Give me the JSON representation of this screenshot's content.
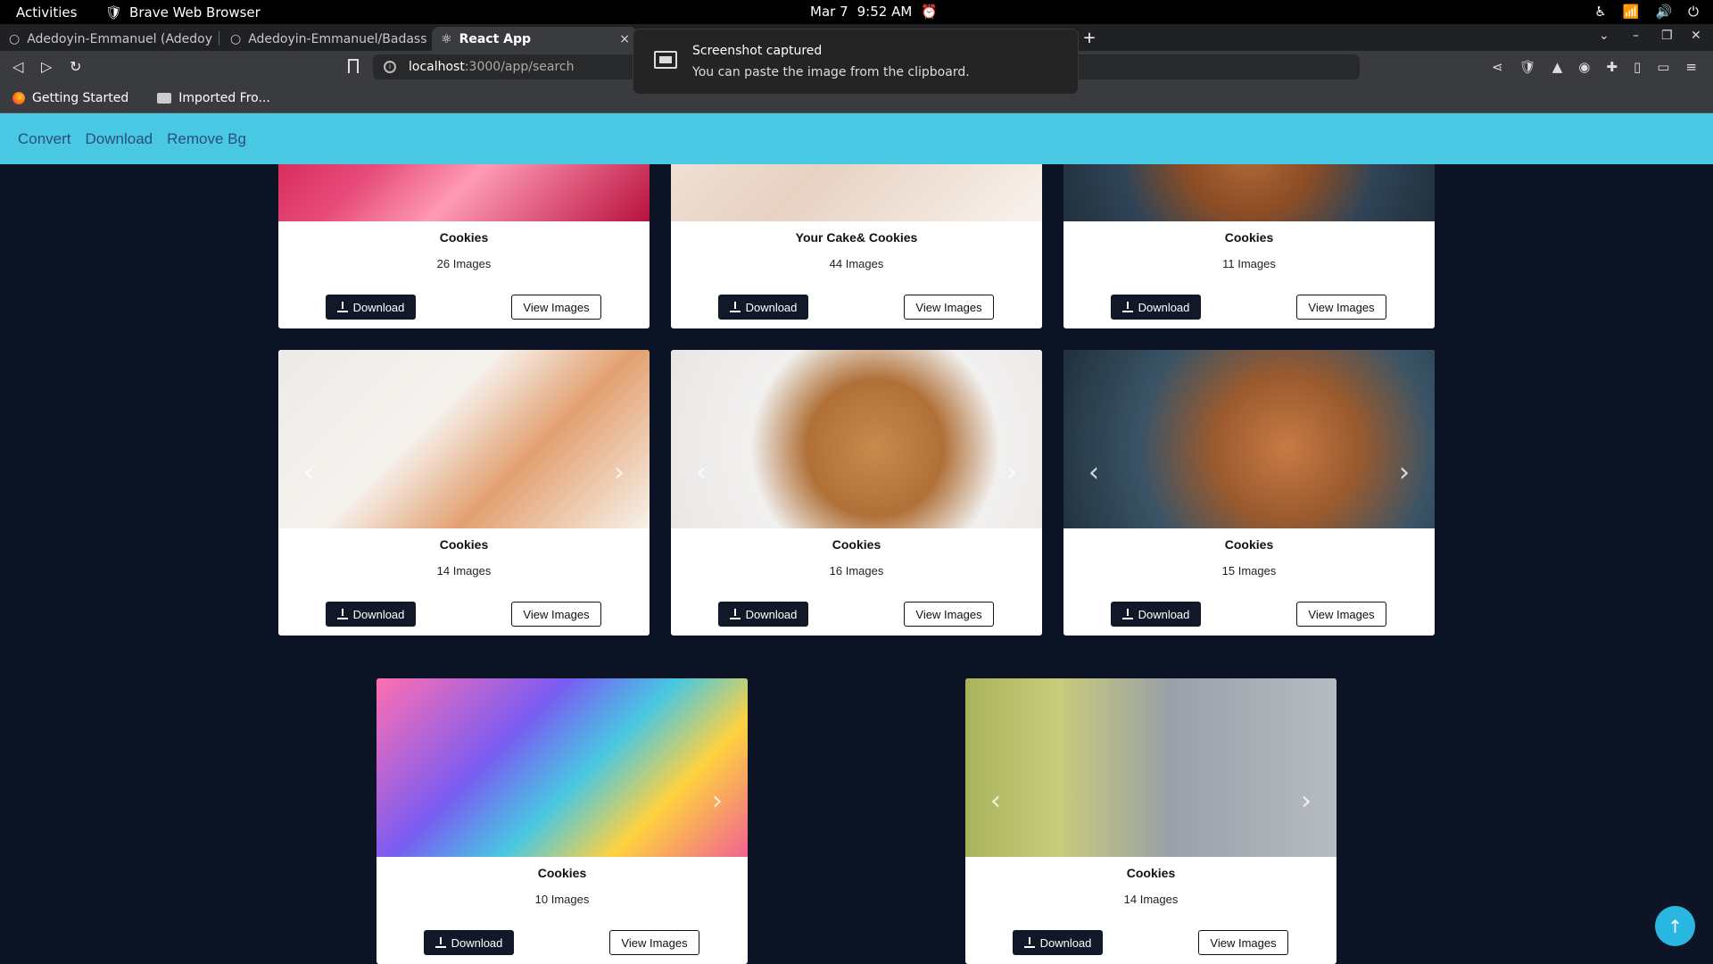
{
  "system": {
    "activities": "Activities",
    "app_name": "Brave Web Browser",
    "date": "Mar 7",
    "time": "9:52 AM"
  },
  "browser": {
    "tabs": [
      {
        "label": "Adedoyin-Emmanuel (Adedoy",
        "active": false
      },
      {
        "label": "Adedoyin-Emmanuel/Badass",
        "active": false
      },
      {
        "label": "React App",
        "active": true
      }
    ],
    "url_host": "localhost",
    "url_path": ":3000/app/search",
    "bookmarks": [
      {
        "label": "Getting Started",
        "icon": "firefox-icon"
      },
      {
        "label": "Imported Fro...",
        "icon": "folder-icon"
      }
    ]
  },
  "notification": {
    "title": "Screenshot captured",
    "body": "You can paste the image from the clipboard."
  },
  "app_nav": {
    "items": [
      "Convert",
      "Download",
      "Remove Bg"
    ]
  },
  "buttons": {
    "download": "Download",
    "view": "View Images"
  },
  "cards": [
    {
      "title": "Cookies",
      "count": "26 Images",
      "image": "valentine-hearts"
    },
    {
      "title": "Your Cake& Cookies",
      "count": "44 Images",
      "image": "cake-sprinkles"
    },
    {
      "title": "Cookies",
      "count": "11 Images",
      "image": "cookies-dark-plate"
    },
    {
      "title": "Cookies",
      "count": "14 Images",
      "image": "macarons-jar"
    },
    {
      "title": "Cookies",
      "count": "16 Images",
      "image": "cookie-sandwich"
    },
    {
      "title": "Cookies",
      "count": "15 Images",
      "image": "cookies-plate"
    },
    {
      "title": "Cookies",
      "count": "10 Images",
      "image": "birthday-party"
    },
    {
      "title": "Cookies",
      "count": "14 Images",
      "image": "green-macaron"
    }
  ],
  "colors": {
    "nav_bar": "#48c8e3",
    "page_bg": "#0d1426",
    "scroll_top": "#29b6e0"
  }
}
